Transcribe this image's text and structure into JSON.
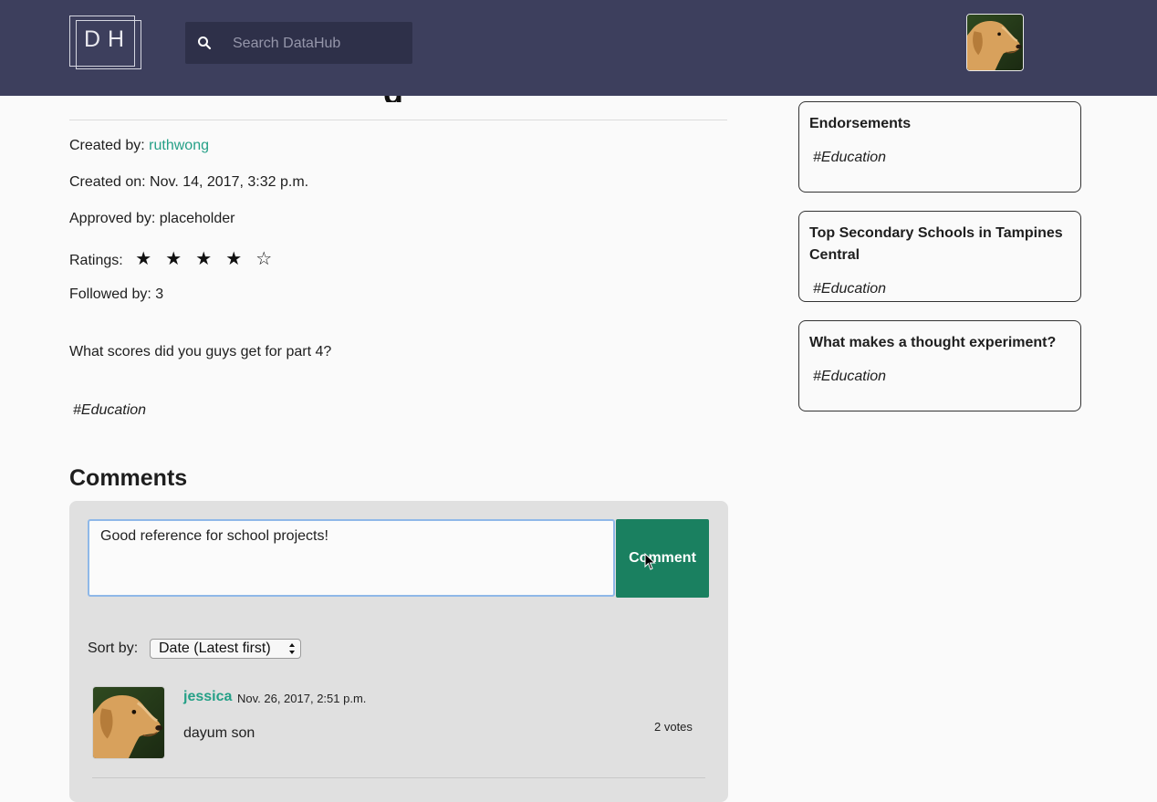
{
  "header": {
    "logo_text": "DH",
    "search_placeholder": "Search DataHub"
  },
  "post": {
    "created_by_label": "Created by:",
    "created_by": "ruthwong",
    "created_on": "Created on: Nov. 14, 2017, 3:32 p.m.",
    "approved_by": "Approved by: placeholder",
    "ratings_label": "Ratings:",
    "rating": 4,
    "rating_max": 5,
    "followed_by": "Followed by: 3",
    "question": "What scores did you guys get for part 4?",
    "tag": "#Education"
  },
  "comments": {
    "heading": "Comments",
    "input_value": "Good reference for school projects!",
    "submit_label": "Comment",
    "sort_label": "Sort by:",
    "sort_selected": "Date (Latest first)",
    "items": [
      {
        "user": "jessica",
        "date": "Nov. 26, 2017, 2:51 p.m.",
        "text": "dayum son",
        "votes": "2 votes"
      }
    ]
  },
  "sidebar": {
    "cards": [
      {
        "title": "Endorsements",
        "tag": "#Education"
      },
      {
        "title": "Top Secondary Schools in Tampines Central",
        "tag": "#Education"
      },
      {
        "title": "What makes a thought experiment?",
        "tag": "#Education"
      }
    ]
  },
  "colors": {
    "header_bg": "#3d3f5d",
    "accent_green": "#25a087",
    "button_green": "#1a8060"
  }
}
